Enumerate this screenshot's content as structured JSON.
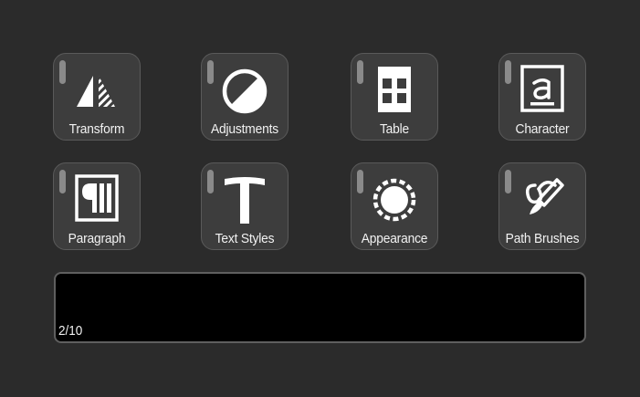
{
  "tiles": [
    {
      "label": "Transform",
      "icon": "transform-icon"
    },
    {
      "label": "Adjustments",
      "icon": "adjustments-icon"
    },
    {
      "label": "Table",
      "icon": "table-icon"
    },
    {
      "label": "Character",
      "icon": "character-icon"
    },
    {
      "label": "Paragraph",
      "icon": "paragraph-icon"
    },
    {
      "label": "Text Styles",
      "icon": "text-styles-icon"
    },
    {
      "label": "Appearance",
      "icon": "appearance-icon"
    },
    {
      "label": "Path Brushes",
      "icon": "path-brushes-icon"
    }
  ],
  "display": {
    "page_indicator": "2/10"
  },
  "colors": {
    "background": "#2b2b2b",
    "tile": "#3d3d3d",
    "tile_border": "#5a5a5a",
    "indicator": "#8a8a8a",
    "icon": "#ffffff"
  }
}
